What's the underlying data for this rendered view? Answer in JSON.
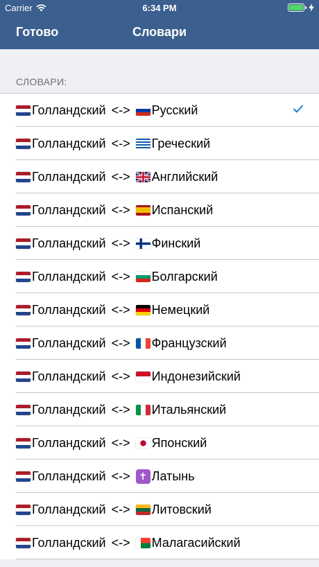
{
  "status": {
    "carrier": "Carrier",
    "time": "6:34 PM"
  },
  "nav": {
    "done": "Готово",
    "title": "Словари"
  },
  "section": {
    "header": "СЛОВАРИ:"
  },
  "colors": {
    "navbar": "#3b5f8e",
    "accent": "#1a7bd2"
  },
  "rows": [
    {
      "source": "Голландский",
      "arrow": "<->",
      "target": "Русский",
      "flag_icon": "russia-flag-icon",
      "selected": true
    },
    {
      "source": "Голландский",
      "arrow": "<->",
      "target": "Греческий",
      "flag_icon": "greece-flag-icon",
      "selected": false
    },
    {
      "source": "Голландский",
      "arrow": "<->",
      "target": "Английский",
      "flag_icon": "uk-flag-icon",
      "selected": false
    },
    {
      "source": "Голландский",
      "arrow": "<->",
      "target": "Испанский",
      "flag_icon": "spain-flag-icon",
      "selected": false
    },
    {
      "source": "Голландский",
      "arrow": "<->",
      "target": "Финский",
      "flag_icon": "finland-flag-icon",
      "selected": false
    },
    {
      "source": "Голландский",
      "arrow": "<->",
      "target": "Болгарский",
      "flag_icon": "bulgaria-flag-icon",
      "selected": false
    },
    {
      "source": "Голландский",
      "arrow": "<->",
      "target": "Немецкий",
      "flag_icon": "germany-flag-icon",
      "selected": false
    },
    {
      "source": "Голландский",
      "arrow": "<->",
      "target": "Французский",
      "flag_icon": "france-flag-icon",
      "selected": false
    },
    {
      "source": "Голландский",
      "arrow": "<->",
      "target": "Индонезийский",
      "flag_icon": "indonesia-flag-icon",
      "selected": false
    },
    {
      "source": "Голландский",
      "arrow": "<->",
      "target": "Итальянский",
      "flag_icon": "italy-flag-icon",
      "selected": false
    },
    {
      "source": "Голландский",
      "arrow": "<->",
      "target": "Японский",
      "flag_icon": "japan-flag-icon",
      "selected": false
    },
    {
      "source": "Голландский",
      "arrow": "<->",
      "target": "Латынь",
      "flag_icon": "latin-cross-icon",
      "selected": false
    },
    {
      "source": "Голландский",
      "arrow": "<->",
      "target": "Литовский",
      "flag_icon": "lithuania-flag-icon",
      "selected": false
    },
    {
      "source": "Голландский",
      "arrow": "<->",
      "target": "Малагасийский",
      "flag_icon": "madagascar-flag-icon",
      "selected": false
    }
  ]
}
